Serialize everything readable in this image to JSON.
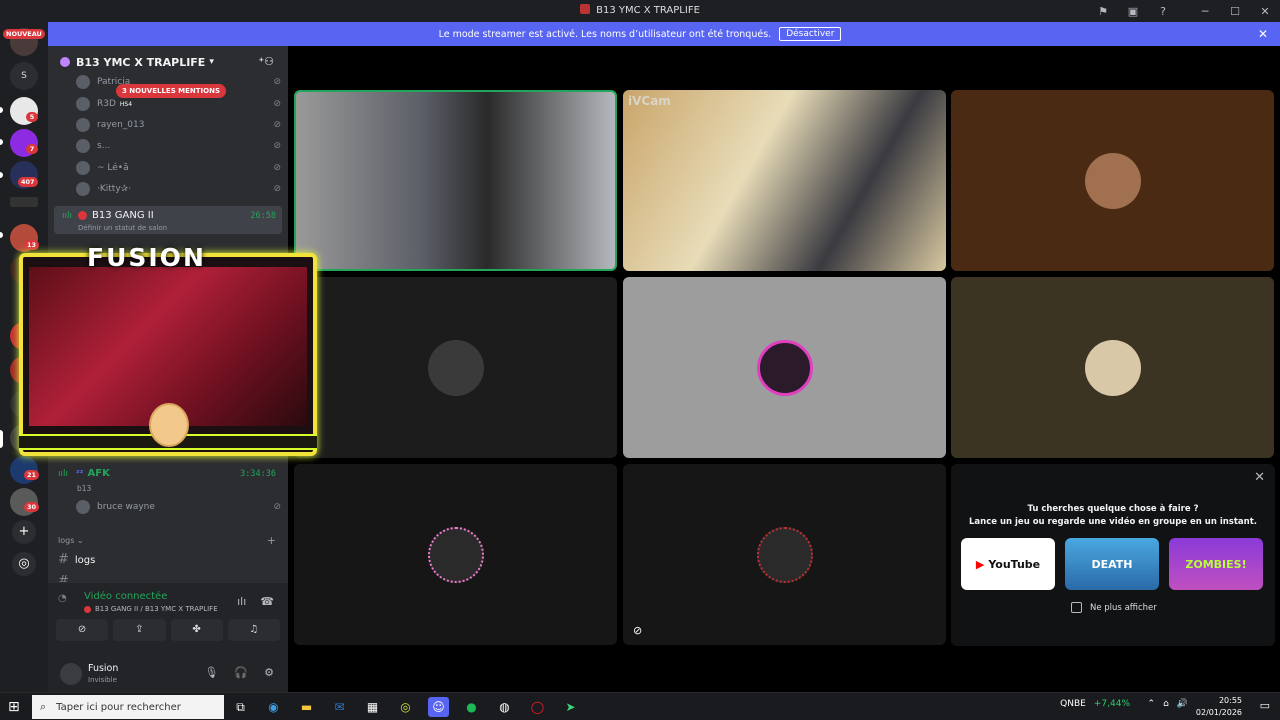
{
  "window": {
    "title": "B13 YMC X TRAPLIFE"
  },
  "banner": {
    "text": "Le mode streamer est activé. Les noms d’utilisateur ont été tronqués.",
    "button": "Désactiver"
  },
  "rail": {
    "new_badge": "NOUVEAU",
    "letter": "S",
    "badges": [
      "5",
      "7",
      "407",
      "13",
      "21",
      "30"
    ]
  },
  "guild": {
    "name": "B13 YMC X TRAPLIFE"
  },
  "mentions": "3 NOUVELLES MENTIONS",
  "voice_users_top": [
    {
      "name": "Patricia"
    },
    {
      "name": "R3D",
      "tag": "HS4"
    },
    {
      "name": "rayen_013"
    },
    {
      "name": "s..."
    },
    {
      "name": "~ Lé•ã"
    },
    {
      "name": "·Kitty✰·"
    }
  ],
  "voice_channel": {
    "name": "B13 GANG II",
    "time": "26:58",
    "status": "Définir un statut de salon"
  },
  "overlay": {
    "title": "FUSION"
  },
  "afk_channel": {
    "name": "AFK",
    "time": "3:34:36",
    "sub": "b13",
    "user": "bruce wayne"
  },
  "category": {
    "name": "logs"
  },
  "text_channels": [
    "logs"
  ],
  "voice_panel": {
    "status": "Vidéo connectée",
    "location": "B13 GANG II / B13 YMC X TRAPLIFE"
  },
  "user": {
    "name": "Fusion",
    "status": "Invisible"
  },
  "video": {
    "cam_label": "iVCam"
  },
  "activity": {
    "line1": "Tu cherches quelque chose à faire ?",
    "line2": "Lance un jeu ou regarde une vidéo en groupe en un instant.",
    "cards": [
      "YouTube",
      "DEATH",
      "ZOMBIES!"
    ],
    "checkbox": "Ne plus afficher"
  },
  "taskbar": {
    "search": "Taper ici pour rechercher",
    "stock_name": "QNBE",
    "stock_change": "+7,44%",
    "time": "20:55",
    "date": "02/01/2026"
  },
  "colors": {
    "accent": "#5865f2",
    "online": "#23a55a",
    "danger": "#da373c",
    "overlay_border": "#f2e33a"
  }
}
